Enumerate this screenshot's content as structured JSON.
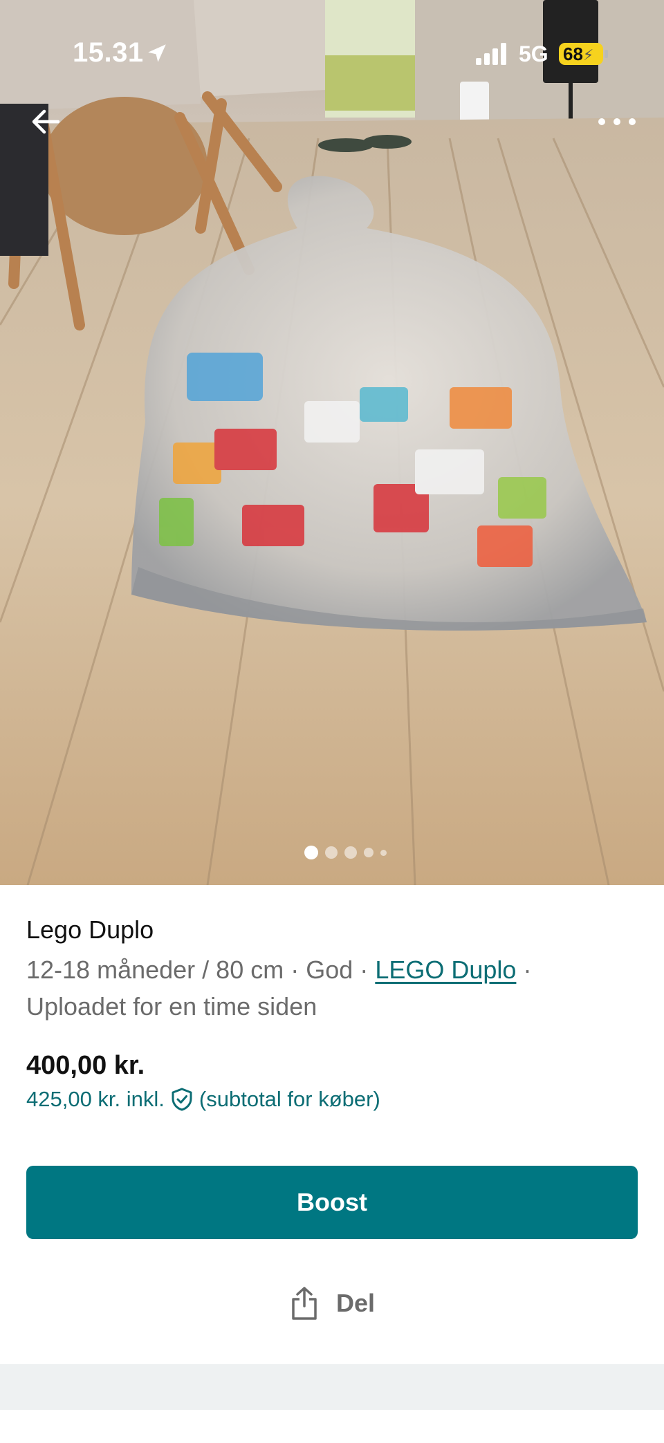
{
  "status_bar": {
    "time": "15.31",
    "network": "5G",
    "battery": "68",
    "location_icon": "location-arrow-icon",
    "signal_icon": "signal-bars-icon",
    "battery_icon": "battery-charging-icon"
  },
  "nav": {
    "back_icon": "arrow-left-icon",
    "more_icon": "more-horizontal-icon"
  },
  "gallery": {
    "image_subject": "bag-of-lego-duplo-photo",
    "page_count": 5,
    "current_page": 1
  },
  "listing": {
    "title": "Lego Duplo",
    "size": "12-18 måneder / 80 cm",
    "separator": "·",
    "condition": "God",
    "brand": "LEGO Duplo",
    "uploaded": "Uploadet for en time siden",
    "price": "400,00 kr.",
    "price_incl": "425,00 kr. inkl.",
    "price_incl_note": "(subtotal for køber)",
    "shield_icon": "shield-check-icon"
  },
  "actions": {
    "boost_label": "Boost",
    "share_label": "Del",
    "share_icon": "share-icon"
  },
  "colors": {
    "accent": "#007782",
    "link": "#0c6d74",
    "muted_text": "#6b6b6b",
    "battery": "#f6d21e",
    "footer_strip": "#eef1f2"
  }
}
